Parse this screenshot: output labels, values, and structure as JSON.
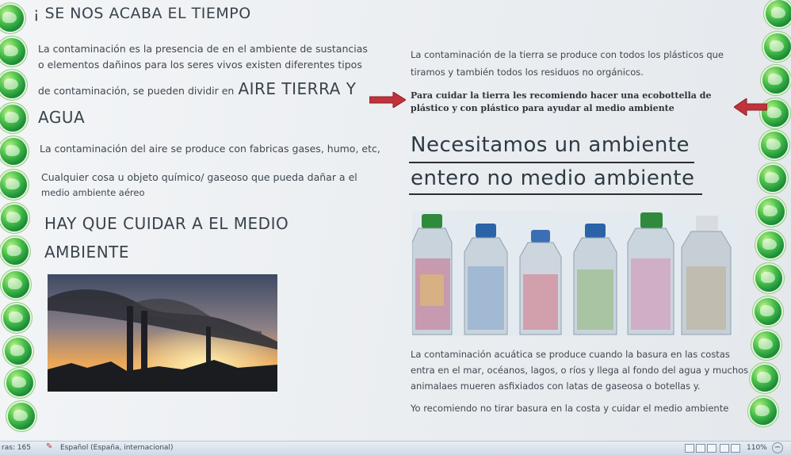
{
  "document": {
    "title": "¡ SE NOS ACABA EL TIEMPO",
    "left": {
      "p1_line1": "La  contaminación  es la presencia de en el ambiente  de sustancias",
      "p1_line2": "o elementos dañinos para los seres vivos  existen diferentes tipos",
      "p1_line3_small": "de  contaminación, se pueden dividir en",
      "p1_line3_big": "AIRE TIERRA Y",
      "p1_line4": "AGUA",
      "p2": "La contaminación del aire se produce con fabricas gases, humo, etc,",
      "p3_line1": "Cualquier cosa u objeto químico/ gaseoso que pueda dañar a el",
      "p3_line2": "medio ambiente aéreo",
      "p4_line1": "HAY QUE CUIDAR A EL MEDIO",
      "p4_line2": "AMBIENTE"
    },
    "right": {
      "earth_line1": "La contaminación de la tierra se produce con todos  los plásticos que",
      "earth_line2": "tiramos y también todos  los residuos no orgánicos.",
      "bold_line1": "Para cuidar la tierra les recomiendo hacer una ecobottella de",
      "bold_line2": "plástico y con plástico para ayudar al medio ambiente",
      "heading_line1": "Necesitamos un ambiente",
      "heading_line2": "entero no medio ambiente",
      "water_line1": "La contaminación acuática se produce cuando la basura en las costas",
      "water_line2": "entra en el mar, océanos, lagos, o ríos y llega al fondo del agua y muchos",
      "water_line3": "animalaes mueren asfixiados con latas de gaseosa o botellas y.",
      "recommend": "Yo recomiendo no tirar basura en la costa y cuidar el medio ambiente"
    }
  },
  "statusbar": {
    "words": "ras: 165",
    "language": "Español (España, internacional)",
    "zoom": "110%"
  },
  "colors": {
    "arrow": "#c0333a",
    "globe": "#2e9e3f",
    "page": "#eef1f4"
  }
}
